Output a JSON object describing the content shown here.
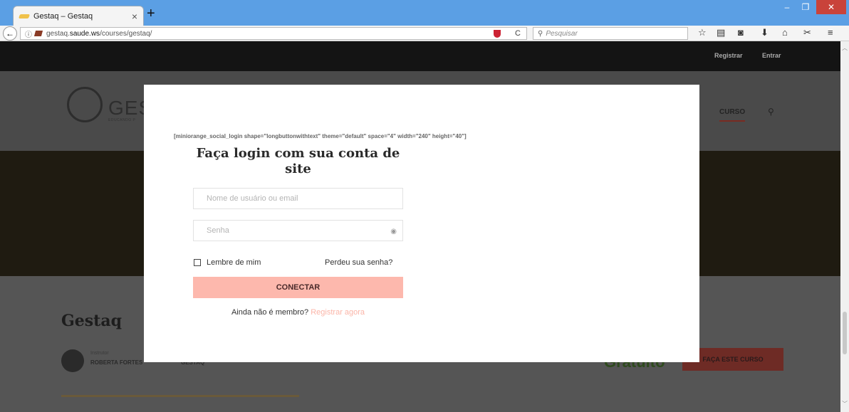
{
  "browser": {
    "tab_title": "Gestaq – Gestaq",
    "url_domain": "gestaq.",
    "url_bold": "saude.ws",
    "url_path": "/courses/gestaq/",
    "search_placeholder": "Pesquisar"
  },
  "site": {
    "top_links": {
      "register": "Registrar",
      "login": "Entrar"
    },
    "logo_text": "GES",
    "logo_sub": "EDUCANDO P",
    "nav_curso": "CURSO"
  },
  "course": {
    "title": "Gestaq",
    "instructor_label": "Instrutor",
    "instructor_name": "ROBERTA FORTES",
    "category": "GESTAQ",
    "price": "Gratuito",
    "cta": "FAÇA ESTE CURSO"
  },
  "modal": {
    "shortcode": "[miniorange_social_login shape=\"longbuttonwithtext\" theme=\"default\" space=\"4\" width=\"240\" height=\"40\"]",
    "title": "Faça login com sua conta de site",
    "username_placeholder": "Nome de usuário ou email",
    "password_placeholder": "Senha",
    "remember_label": "Lembre de mim",
    "forgot_link": "Perdeu sua senha?",
    "connect_button": "CONECTAR",
    "not_member": "Ainda não é membro?",
    "register_link": "Registrar agora"
  },
  "colors": {
    "button": "#fdb8ad",
    "link": "#fbb5a8",
    "overlay_top": "#141414"
  }
}
